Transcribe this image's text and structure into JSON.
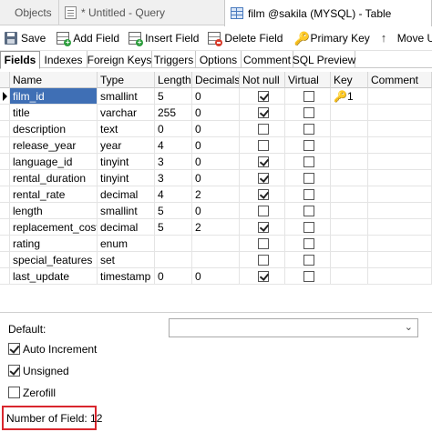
{
  "window_tabs": [
    {
      "label": "Objects"
    },
    {
      "label": "* Untitled - Query"
    },
    {
      "label": "film @sakila (MYSQL) - Table"
    }
  ],
  "toolbar": {
    "save": "Save",
    "add_field": "Add Field",
    "insert_field": "Insert Field",
    "delete_field": "Delete Field",
    "primary_key": "Primary Key",
    "move_up": "Move Up"
  },
  "sub_tabs": [
    "Fields",
    "Indexes",
    "Foreign Keys",
    "Triggers",
    "Options",
    "Comment",
    "SQL Preview"
  ],
  "columns": {
    "name": "Name",
    "type": "Type",
    "length": "Length",
    "decimals": "Decimals",
    "not_null": "Not null",
    "virtual": "Virtual",
    "key": "Key",
    "comment": "Comment"
  },
  "fields": [
    {
      "name": "film_id",
      "type": "smallint",
      "length": "5",
      "decimals": "0",
      "not_null": true,
      "virtual": false,
      "key": "1"
    },
    {
      "name": "title",
      "type": "varchar",
      "length": "255",
      "decimals": "0",
      "not_null": true,
      "virtual": false,
      "key": ""
    },
    {
      "name": "description",
      "type": "text",
      "length": "0",
      "decimals": "0",
      "not_null": false,
      "virtual": false,
      "key": ""
    },
    {
      "name": "release_year",
      "type": "year",
      "length": "4",
      "decimals": "0",
      "not_null": false,
      "virtual": false,
      "key": ""
    },
    {
      "name": "language_id",
      "type": "tinyint",
      "length": "3",
      "decimals": "0",
      "not_null": true,
      "virtual": false,
      "key": ""
    },
    {
      "name": "rental_duration",
      "type": "tinyint",
      "length": "3",
      "decimals": "0",
      "not_null": true,
      "virtual": false,
      "key": ""
    },
    {
      "name": "rental_rate",
      "type": "decimal",
      "length": "4",
      "decimals": "2",
      "not_null": true,
      "virtual": false,
      "key": ""
    },
    {
      "name": "length",
      "type": "smallint",
      "length": "5",
      "decimals": "0",
      "not_null": false,
      "virtual": false,
      "key": ""
    },
    {
      "name": "replacement_cost",
      "type": "decimal",
      "length": "5",
      "decimals": "2",
      "not_null": true,
      "virtual": false,
      "key": ""
    },
    {
      "name": "rating",
      "type": "enum",
      "length": "",
      "decimals": "",
      "not_null": false,
      "virtual": false,
      "key": ""
    },
    {
      "name": "special_features",
      "type": "set",
      "length": "",
      "decimals": "",
      "not_null": false,
      "virtual": false,
      "key": ""
    },
    {
      "name": "last_update",
      "type": "timestamp",
      "length": "0",
      "decimals": "0",
      "not_null": true,
      "virtual": false,
      "key": ""
    }
  ],
  "properties": {
    "default_label": "Default:",
    "default_value": "",
    "auto_increment": {
      "label": "Auto Increment",
      "checked": true
    },
    "unsigned": {
      "label": "Unsigned",
      "checked": true
    },
    "zerofill": {
      "label": "Zerofill",
      "checked": false
    }
  },
  "status": {
    "text": "Number of Field: 12"
  },
  "colors": {
    "selection": "#3f6fb5",
    "key": "#c9951a",
    "status_border": "#d9262d"
  }
}
